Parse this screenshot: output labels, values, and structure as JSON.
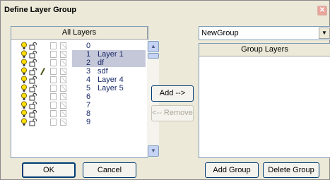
{
  "window": {
    "title": "Define Layer Group",
    "close_glyph": "✕"
  },
  "left_panel": {
    "header": "All Layers",
    "layers": [
      {
        "num": "0",
        "name": "",
        "selected": false,
        "pencil": false
      },
      {
        "num": "1",
        "name": "Layer 1",
        "selected": true,
        "pencil": false
      },
      {
        "num": "2",
        "name": "df",
        "selected": true,
        "pencil": false
      },
      {
        "num": "3",
        "name": "sdf",
        "selected": false,
        "pencil": true
      },
      {
        "num": "4",
        "name": "Layer 4",
        "selected": false,
        "pencil": false
      },
      {
        "num": "5",
        "name": "Layer 5",
        "selected": false,
        "pencil": false
      },
      {
        "num": "6",
        "name": "",
        "selected": false,
        "pencil": false
      },
      {
        "num": "7",
        "name": "",
        "selected": false,
        "pencil": false
      },
      {
        "num": "8",
        "name": "",
        "selected": false,
        "pencil": false
      },
      {
        "num": "9",
        "name": "",
        "selected": false,
        "pencil": false
      }
    ]
  },
  "middle": {
    "add_label": "Add -->",
    "remove_label": "<-- Remove"
  },
  "right_panel": {
    "group_select_value": "NewGroup",
    "header": "Group Layers"
  },
  "footer": {
    "ok_label": "OK",
    "cancel_label": "Cancel",
    "add_group_label": "Add Group",
    "delete_group_label": "Delete Group"
  },
  "colors": {
    "accent": "#003c74",
    "selection": "#c5c8d9",
    "bulb": "#ffde00"
  }
}
